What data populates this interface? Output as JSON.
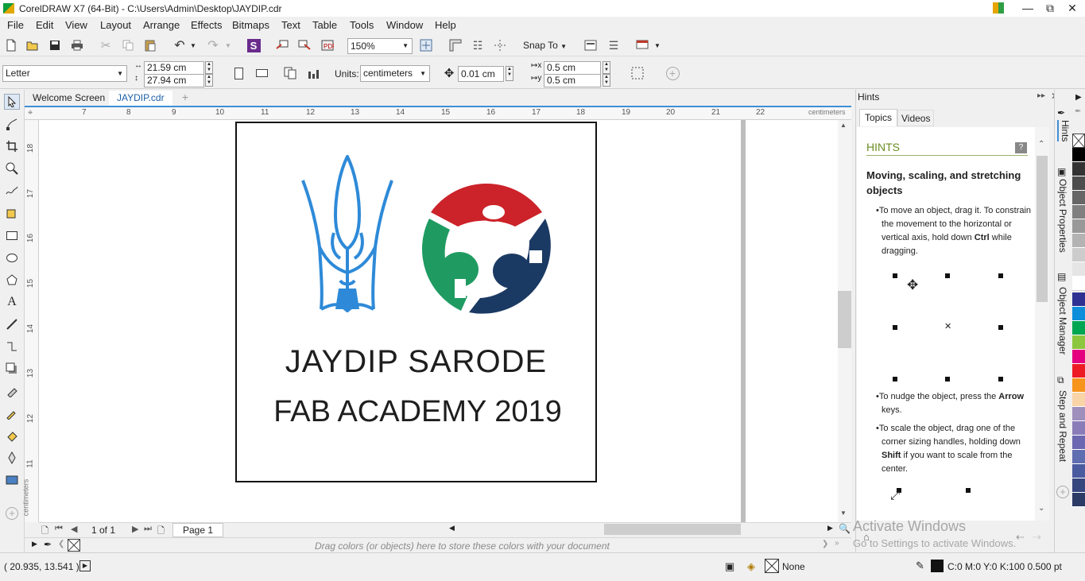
{
  "window": {
    "title": "CorelDRAW X7 (64-Bit) - C:\\Users\\Admin\\Desktop\\JAYDIP.cdr"
  },
  "menu": [
    "File",
    "Edit",
    "View",
    "Layout",
    "Arrange",
    "Effects",
    "Bitmaps",
    "Text",
    "Table",
    "Tools",
    "Window",
    "Help"
  ],
  "toolbar": {
    "zoom": "150%",
    "snap_label": "Snap To"
  },
  "property_bar": {
    "page_size": "Letter",
    "width": "21.59 cm",
    "height": "27.94 cm",
    "units_label": "Units:",
    "units": "centimeters",
    "nudge": "0.01 cm",
    "dup_x": "0.5 cm",
    "dup_y": "0.5 cm"
  },
  "doc_tabs": [
    "Welcome Screen",
    "JAYDIP.cdr"
  ],
  "ruler": {
    "h_ticks": [
      "7",
      "8",
      "9",
      "10",
      "11",
      "12",
      "13",
      "14",
      "15",
      "16",
      "17",
      "18",
      "19",
      "20",
      "21",
      "22"
    ],
    "h_units": "centimeters",
    "v_ticks": [
      "18",
      "17",
      "16",
      "15",
      "14",
      "13",
      "12",
      "11"
    ],
    "v_units": "centimeters"
  },
  "artwork": {
    "line1": "JAYDIP SARODE",
    "line2": "FAB ACADEMY 2019"
  },
  "page_nav": {
    "count": "1 of 1",
    "tab": "Page 1"
  },
  "color_strip_hint": "Drag colors (or objects) here to store these colors with your document",
  "status": {
    "coords": "( 20.935, 13.541 )",
    "fill": "None",
    "outline": "C:0 M:0 Y:0 K:100  0.500 pt"
  },
  "hints": {
    "panel_title": "Hints",
    "tabs": [
      "Topics",
      "Videos"
    ],
    "heading": "HINTS",
    "title": "Moving, scaling, and stretching objects",
    "b1_pre": "To move an object, drag it. To constrain the movement to the horizontal or vertical axis, hold down ",
    "b1_key": "Ctrl",
    "b1_post": " while dragging.",
    "b2_pre": "To nudge the object, press the ",
    "b2_key": "Arrow",
    "b2_post": " keys.",
    "b3_pre": "To scale the object, drag one of the corner sizing handles, holding down ",
    "b3_key": "Shift",
    "b3_post": " if you want to scale from the center."
  },
  "dock_tabs": [
    "Hints",
    "Object Properties",
    "Object Manager",
    "Step and Repeat"
  ],
  "watermark": {
    "line1": "Activate Windows",
    "line2": "Go to Settings to activate Windows."
  },
  "colors": {
    "accent": "#3e8fd4",
    "hints_heading": "#6b8e23",
    "logo_blue": "#2e8ad8",
    "fab_red": "#cc2229",
    "fab_green": "#1f9b62",
    "fab_navy": "#1b3a63"
  }
}
